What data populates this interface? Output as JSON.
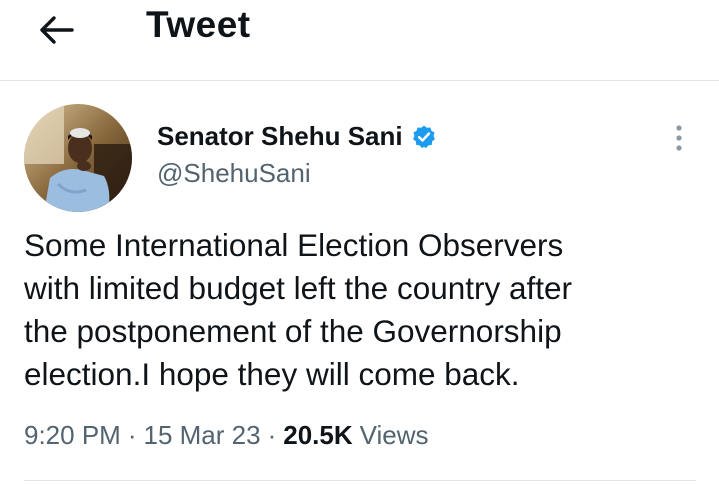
{
  "header": {
    "title": "Tweet",
    "back_icon": "arrow-left-icon"
  },
  "author": {
    "name": "Senator Shehu Sani",
    "handle": "@ShehuSani",
    "verified_icon": "verified-badge-icon",
    "verified_color": "#1d9bf0"
  },
  "tweet": {
    "text": "Some International Election Observers\nwith limited budget left the country after\nthe postponement of the Governorship\nelection.I hope they will come back.",
    "time": "9:20 PM",
    "separator": "·",
    "date": "15 Mar 23",
    "views_count": "20.5K",
    "views_label": "Views"
  },
  "colors": {
    "text_primary": "#0f1419",
    "text_secondary": "#536471",
    "divider": "#e1e4e8"
  }
}
